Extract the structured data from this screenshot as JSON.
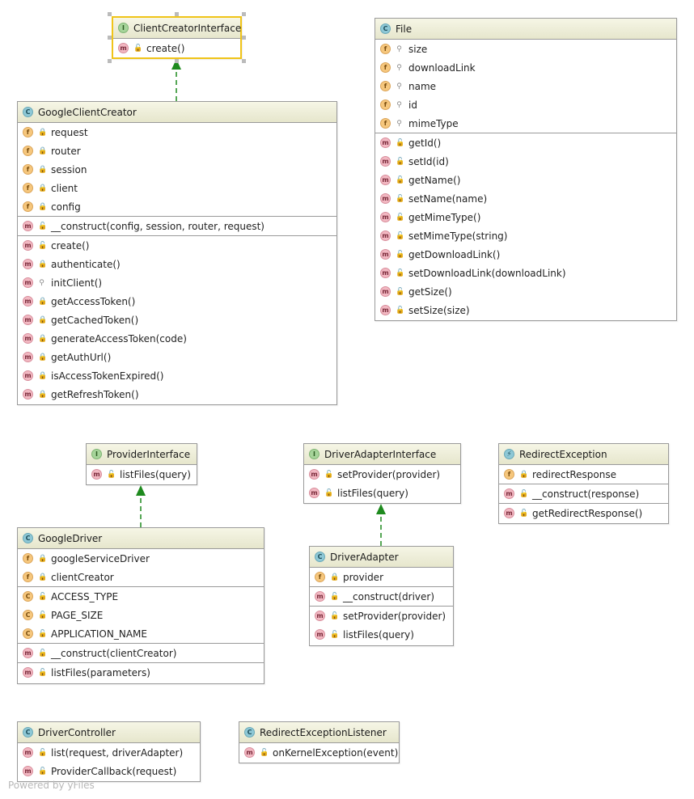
{
  "classes": {
    "client_creator_interface": {
      "title": "ClientCreatorInterface",
      "badge": "I",
      "methods": [
        "create()"
      ]
    },
    "file": {
      "title": "File",
      "badge": "C",
      "fields": [
        "size",
        "downloadLink",
        "name",
        "id",
        "mimeType"
      ],
      "methods": [
        "getId()",
        "setId(id)",
        "getName()",
        "setName(name)",
        "getMimeType()",
        "setMimeType(string)",
        "getDownloadLink()",
        "setDownloadLink(downloadLink)",
        "getSize()",
        "setSize(size)"
      ]
    },
    "google_client_creator": {
      "title": "GoogleClientCreator",
      "badge": "C",
      "fields": [
        "request",
        "router",
        "session",
        "client",
        "config"
      ],
      "constructor": "__construct(config, session, router, request)",
      "methods": [
        "create()",
        "authenticate()",
        "initClient()",
        "getAccessToken()",
        "getCachedToken()",
        "generateAccessToken(code)",
        "getAuthUrl()",
        "isAccessTokenExpired()",
        "getRefreshToken()"
      ]
    },
    "provider_interface": {
      "title": "ProviderInterface",
      "badge": "I",
      "methods": [
        "listFiles(query)"
      ]
    },
    "driver_adapter_interface": {
      "title": "DriverAdapterInterface",
      "badge": "I",
      "methods": [
        "setProvider(provider)",
        "listFiles(query)"
      ]
    },
    "redirect_exception": {
      "title": "RedirectException",
      "badge": "⚡",
      "fields": [
        "redirectResponse"
      ],
      "constructor": "__construct(response)",
      "methods": [
        "getRedirectResponse()"
      ]
    },
    "google_driver": {
      "title": "GoogleDriver",
      "badge": "C",
      "fields": [
        "googleServiceDriver",
        "clientCreator"
      ],
      "constants": [
        "ACCESS_TYPE",
        "PAGE_SIZE",
        "APPLICATION_NAME"
      ],
      "constructor": "__construct(clientCreator)",
      "methods": [
        "listFiles(parameters)"
      ]
    },
    "driver_adapter": {
      "title": "DriverAdapter",
      "badge": "C",
      "fields": [
        "provider"
      ],
      "constructor": "__construct(driver)",
      "methods": [
        "setProvider(provider)",
        "listFiles(query)"
      ]
    },
    "driver_controller": {
      "title": "DriverController",
      "badge": "C",
      "methods": [
        "list(request, driverAdapter)",
        "ProviderCallback(request)"
      ]
    },
    "redirect_exception_listener": {
      "title": "RedirectExceptionListener",
      "badge": "C",
      "methods": [
        "onKernelException(event)"
      ]
    }
  },
  "member_badges": {
    "method": "m",
    "field": "f",
    "constant": "C"
  },
  "visibility_icons": {
    "public": "🔓",
    "private": "🔒",
    "protected": "⚲"
  },
  "colors": {
    "header_bg": "#ececd6",
    "border": "#9a9a9a",
    "selection": "#f0c419",
    "arrow": "#1e8a1e",
    "class_badge": "#8ec8d6",
    "interface_badge": "#a6d49a",
    "method_badge": "#f2b8c2",
    "field_badge": "#f6c77d"
  },
  "watermark": "Powered by yFiles"
}
